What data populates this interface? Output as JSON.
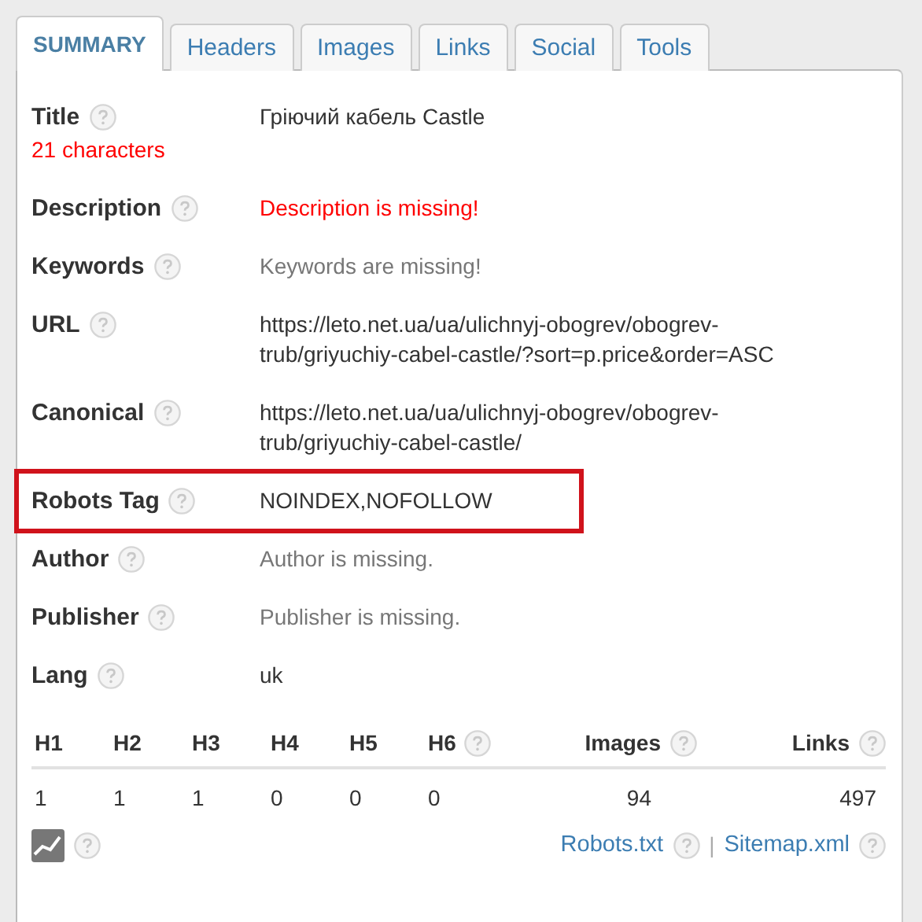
{
  "tabs": [
    {
      "label": "SUMMARY",
      "selected": true
    },
    {
      "label": "Headers",
      "selected": false
    },
    {
      "label": "Images",
      "selected": false
    },
    {
      "label": "Links",
      "selected": false
    },
    {
      "label": "Social",
      "selected": false
    },
    {
      "label": "Tools",
      "selected": false
    }
  ],
  "fields": [
    {
      "label": "Title",
      "note": "21 characters",
      "kind": "normal",
      "value": "Гріючий кабель Castle",
      "highlighted": false
    },
    {
      "label": "Description",
      "kind": "error",
      "value": "Description is missing!",
      "highlighted": false
    },
    {
      "label": "Keywords",
      "kind": "missing",
      "value": "Keywords are missing!",
      "highlighted": false
    },
    {
      "label": "URL",
      "kind": "normal",
      "value": "https://leto.net.ua/ua/ulichnyj-obogrev/obogrev-trub/griyuchiy-cabel-castle/?sort=p.price&order=ASC",
      "highlighted": false
    },
    {
      "label": "Canonical",
      "kind": "normal",
      "value": "https://leto.net.ua/ua/ulichnyj-obogrev/obogrev-trub/griyuchiy-cabel-castle/",
      "highlighted": false
    },
    {
      "label": "Robots Tag",
      "kind": "normal",
      "value": "NOINDEX,NOFOLLOW",
      "highlighted": true
    },
    {
      "label": "Author",
      "kind": "missing",
      "value": "Author is missing.",
      "highlighted": false
    },
    {
      "label": "Publisher",
      "kind": "missing",
      "value": "Publisher is missing.",
      "highlighted": false
    },
    {
      "label": "Lang",
      "kind": "normal",
      "value": "uk",
      "highlighted": false
    }
  ],
  "stats": {
    "headers": [
      "H1",
      "H2",
      "H3",
      "H4",
      "H5",
      "H6"
    ],
    "header_values": [
      "1",
      "1",
      "1",
      "0",
      "0",
      "0"
    ],
    "images": {
      "label": "Images",
      "value": "94"
    },
    "links": {
      "label": "Links",
      "value": "497"
    }
  },
  "footer_links": [
    "Robots.txt",
    "Sitemap.xml"
  ],
  "separator": "|"
}
